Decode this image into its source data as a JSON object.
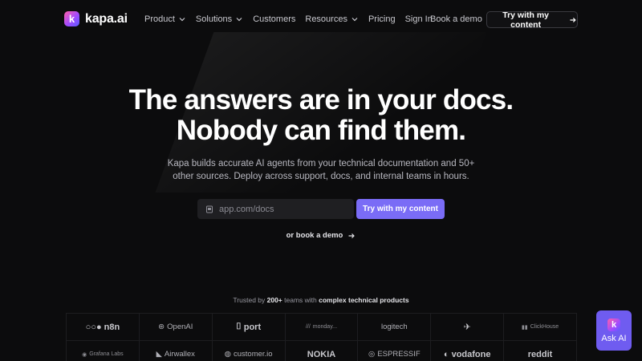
{
  "brand": {
    "name": "kapa.ai",
    "mark": "k"
  },
  "nav": {
    "links": [
      {
        "label": "Product",
        "dropdown": true
      },
      {
        "label": "Solutions",
        "dropdown": true
      },
      {
        "label": "Customers",
        "dropdown": false
      },
      {
        "label": "Resources",
        "dropdown": true
      },
      {
        "label": "Pricing",
        "dropdown": false
      },
      {
        "label": "Sign In",
        "dropdown": false
      }
    ],
    "book_demo": "Book a demo",
    "try_button": "Try with my content"
  },
  "hero": {
    "title_line1": "The answers are in your docs.",
    "title_line2": "Nobody can find them.",
    "subtitle": "Kapa builds accurate AI agents from your technical documentation and 50+ other sources. Deploy across support, docs, and internal teams in hours.",
    "input_placeholder": "app.com/docs",
    "try_button": "Try with my content",
    "or_demo": "or book a demo"
  },
  "trusted": {
    "prefix": "Trusted by ",
    "count": "200+",
    "middle": " teams with ",
    "emphasis": "complex technical products"
  },
  "logos": [
    {
      "name": "n8n",
      "glyph": "○○●",
      "style": "lg-big"
    },
    {
      "name": "OpenAI",
      "glyph": "⊛",
      "style": "lg-med"
    },
    {
      "name": "port",
      "glyph": "⌷",
      "style": "lg-big"
    },
    {
      "name": "monday...",
      "glyph": "///",
      "style": "lg-small"
    },
    {
      "name": "logitech",
      "glyph": "",
      "style": "lg-med"
    },
    {
      "name": "",
      "glyph": "✈",
      "style": "lg-big"
    },
    {
      "name": "ClickHouse",
      "glyph": "▮▮",
      "style": "lg-small"
    },
    {
      "name": "Grafana Labs",
      "glyph": "◉",
      "style": "lg-small"
    },
    {
      "name": "Airwallex",
      "glyph": "◣",
      "style": "lg-med"
    },
    {
      "name": "customer.io",
      "glyph": "◍",
      "style": "lg-med"
    },
    {
      "name": "NOKIA",
      "glyph": "",
      "style": "lg-big"
    },
    {
      "name": "ESPRESSIF",
      "glyph": "◎",
      "style": "lg-med"
    },
    {
      "name": "vodafone",
      "glyph": "◐",
      "style": "lg-big"
    },
    {
      "name": "reddit",
      "glyph": "",
      "style": "lg-big"
    }
  ],
  "ask_ai": {
    "mark": "k",
    "label": "Ask AI"
  },
  "colors": {
    "accent": "#7a6cf6",
    "background": "#0c0c0d",
    "ask_ai": "#6f5cf0"
  }
}
